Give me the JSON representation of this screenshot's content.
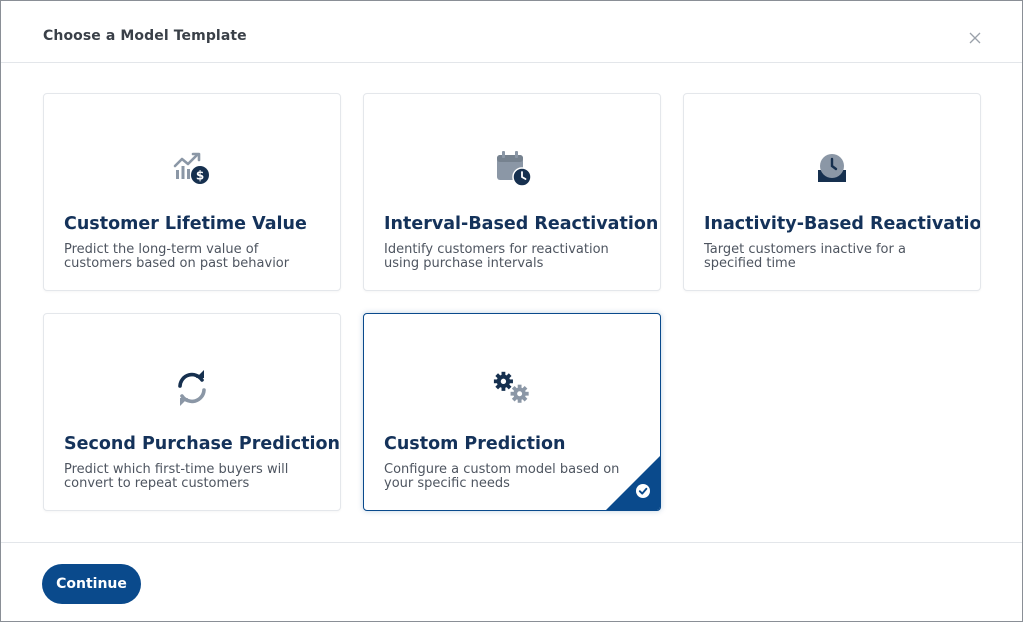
{
  "modal": {
    "title": "Choose a Model Template"
  },
  "colors": {
    "accent": "#0a4a8c",
    "title_text": "#14325a",
    "icon_gray": "#8b97a6",
    "icon_dark": "#16304f"
  },
  "cards": [
    {
      "title": "Customer Lifetime Value",
      "description": "Predict the long-term value of customers based on past behavior",
      "icon": "chart-dollar-icon",
      "selected": false
    },
    {
      "title": "Interval-Based Reactivation",
      "description": "Identify customers for reactivation using purchase intervals",
      "icon": "calendar-clock-icon",
      "selected": false
    },
    {
      "title": "Inactivity-Based Reactivation",
      "description": "Target customers inactive for a specified time",
      "icon": "clock-inbox-icon",
      "selected": false
    },
    {
      "title": "Second Purchase Prediction",
      "description": "Predict which first-time buyers will convert to repeat customers",
      "icon": "refresh-icon",
      "selected": false
    },
    {
      "title": "Custom Prediction",
      "description": "Configure a custom model based on your specific needs",
      "icon": "gears-icon",
      "selected": true
    }
  ],
  "footer": {
    "continue_label": "Continue"
  }
}
